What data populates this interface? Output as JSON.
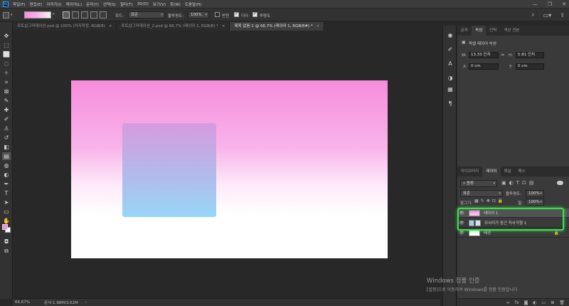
{
  "app": {
    "logo": "Ps",
    "menu": [
      "파일(F)",
      "편집(E)",
      "이미지(I)",
      "레이어(L)",
      "문자(Y)",
      "선택(S)",
      "필터(T)",
      "3D(D)",
      "보기(V)",
      "창(W)",
      "도움말(H)"
    ],
    "window_controls": [
      "—",
      "❐",
      "✕"
    ]
  },
  "options": {
    "mode_label": "모드:",
    "mode_value": "표준",
    "opacity_label": "불투명도:",
    "opacity_value": "100%",
    "reverse_label": "반전",
    "dither_label": "디더",
    "transparency_label": "투명도",
    "reverse_checked": false,
    "dither_checked": true,
    "transparency_checked": true
  },
  "tabs": [
    {
      "label": "포토샵그라데이션.psd @ 100% (아지작정, RGB/8)",
      "active": false
    },
    {
      "label": "포토샵그라데이션_2.psd @ 66.7% (레이어 1, RGB/8) *",
      "active": false
    },
    {
      "label": "제목 없음-1 @ 66.7% (레이어 1, RGB/8#) *",
      "active": true
    }
  ],
  "status": {
    "zoom": "66.67%",
    "doc_size": "문서:1.98M/3.62M",
    "arrow": "›"
  },
  "properties": {
    "tabs": [
      "문자",
      "속성",
      "단락",
      "색상 견본"
    ],
    "active_tab": 1,
    "header": "픽셀 레이어 속성",
    "w_label": "W:",
    "w_value": "13.33 인치",
    "h_label": "H:",
    "h_value": "5.81 인치",
    "x_label": "X:",
    "x_value": "0 cm",
    "y_label": "Y:",
    "y_value": "0 cm"
  },
  "layers": {
    "tabs": [
      "라이브러리",
      "레이어",
      "채널",
      "패스"
    ],
    "active_tab": 1,
    "filter_value": "종류",
    "blend_value": "표준",
    "opacity_label": "불투명도:",
    "opacity_value": "100%",
    "lock_label": "잠그기:",
    "fill_label": "칠:",
    "fill_value": "100%",
    "items": [
      {
        "name": "레이어 1",
        "selected": true,
        "thumb": "pink-gradient"
      },
      {
        "name": "모서리가 둥근 직사각형 1",
        "selected": false,
        "thumb": "shape"
      },
      {
        "name": "배경",
        "selected": false,
        "thumb": "white",
        "locked": true
      }
    ]
  },
  "watermark": {
    "title": "Windows 정품 인증",
    "subtitle": "[설정]으로 이동하여 Windows를 정품 인증합니다."
  },
  "colors": {
    "foreground": "#f58fdf",
    "background": "#ffffff",
    "highlight": "#37e048"
  }
}
